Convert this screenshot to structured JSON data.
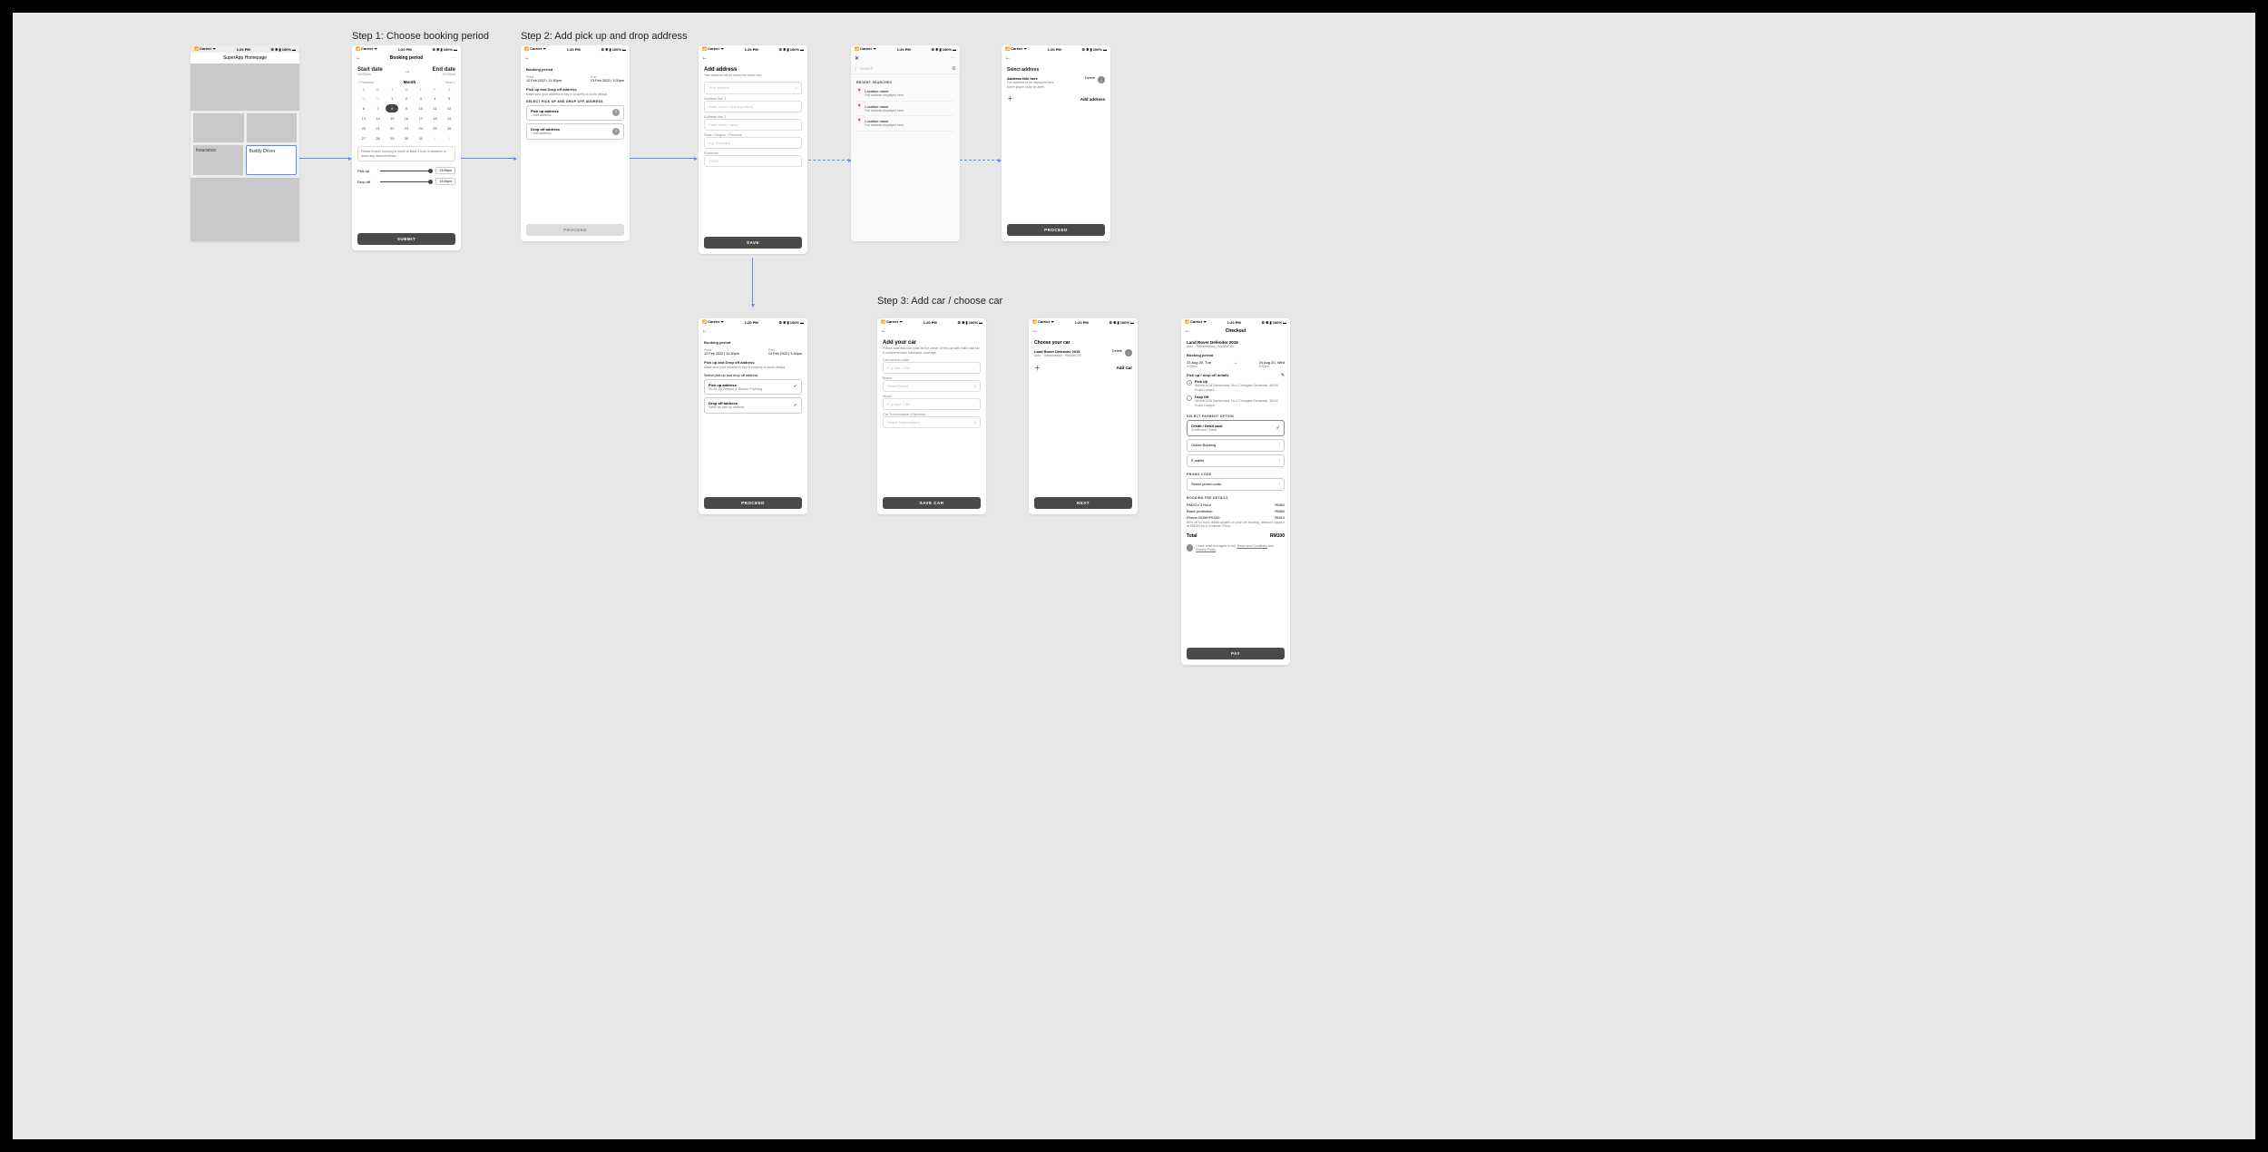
{
  "steps": {
    "s1": "Step 1: Choose booking period",
    "s2": "Step 2: Add pick up and drop address",
    "s3": "Step 3: Add car / choose car"
  },
  "status": {
    "carrier": "Carrier",
    "time": "1:20 PM",
    "battery": "100%"
  },
  "home": {
    "title": "SuperApp Homepage",
    "tile1": "Insurance",
    "tile2": "Buddy Driver"
  },
  "period": {
    "title": "Booking period",
    "start_label": "Start date",
    "start_time": "10:00pm",
    "end_label": "End date",
    "end_time": "10:00pm",
    "prev": "< Previous",
    "month": "Month",
    "next": "Next >",
    "dow": [
      "S",
      "M",
      "T",
      "W",
      "T",
      "F",
      "S"
    ],
    "note": "Please ensure booking is made at least 1 hour in advance to avoid any inconvenience.",
    "pickup": "Pick up",
    "dropoff": "Drop off",
    "slot": "13:00pm",
    "submit": "SUBMIT"
  },
  "step2a": {
    "bp_title": "Booking period",
    "start_l": "Start",
    "start_v": "12 Feb 2022 | 11:30pm",
    "end_l": "End",
    "end_v": "13 Feb 2022 | 3:30pm",
    "pd_title": "Pick up and Drop off address",
    "pd_help": "Make sure your address is key in properly to avoid delays.",
    "sel_title": "SELECT PICK UP AND DROP OFF ADDRESS",
    "pick_t": "Pick up address",
    "pick_s": "+ Add address",
    "drop_t": "Drop off address",
    "drop_s": "+ Add address",
    "proceed": "PROCEED"
  },
  "addaddr": {
    "title": "Add address",
    "sub": "Your address will be saved for future use.",
    "f_your": "Your address",
    "l_l1": "Address line 1",
    "p_l1": "Enter home / building name",
    "l_l2": "Address line 2",
    "p_l2": "Enter street / area",
    "l_state": "State / Region / Province",
    "p_state": "e.g. Selangor",
    "l_post": "Postcode",
    "p_post": "47000",
    "save": "SAVE"
  },
  "search": {
    "ph": "Search",
    "recent": "RECENT SEARCHES",
    "name": "Location name",
    "sub": "Full address displayed here."
  },
  "seladdr": {
    "title": "Select address",
    "card_t": "Address title here",
    "card_s1": "Full address to be displayed here",
    "card_s2": "lorem ipsum dolor sit amet.",
    "delete": "Delete",
    "add": "Add address",
    "proceed": "PROCEED"
  },
  "step3a": {
    "sel_title": "Select pick up and drop off address",
    "pick_s": "No.26 Jln Tempua 5, Bandar Puchong",
    "drop_s": "Same as pick up address",
    "proceed": "PROCEED"
  },
  "addcar": {
    "title": "Add your car",
    "sub": "Please note that you must be the owner of this car with valid road tax & comprehensive insurance coverage.",
    "l_plate": "Car number plate",
    "p_plate": "E.g VAA 1234",
    "l_brand": "Brand",
    "p_brand": "Select Brand",
    "l_model": "Model",
    "p_model": "E.g Myvi 1.5H",
    "l_trans": "Car Transmission (Optional)",
    "p_trans": "Select Transmission",
    "save": "SAVE CAR"
  },
  "choosecar": {
    "title": "Choose your car",
    "car_t": "Land Rover Defender 2015",
    "car_s": "Auto · Transmission · WWW9700",
    "delete": "Delete",
    "add": "Add Car",
    "next": "NEXT"
  },
  "checkout": {
    "title": "Checkout",
    "car_t": "Land Rover Defender 2015",
    "car_s": "Auto · Transmission · WWW9700",
    "bp": "Booking period",
    "d1": "23 Aug 20, Tue",
    "d1t": "4:30pm",
    "d2": "24 Aug 20, Wed",
    "d2t": "6:30pm",
    "pdo_title": "Pick up / drop off details",
    "pu_l": "Pick Up",
    "pu_a": "Wisma UOA Damansara, No.1 Changkat Semantan, 48100 Kuala Lumpur.",
    "do_l": "Drop Off",
    "do_a": "Wisma UOA Damansara, No.1 Changkat Semantan, 48100 Kuala Lumpur.",
    "pay_title": "SELECT PAYMENT OPTION",
    "pay_card": "Credit / Debit card",
    "pay_card_s": "Credit card / Debit",
    "pay_ob": "Online Banking",
    "pay_ew": "E-wallet",
    "promo_t": "PROMO CODE",
    "promo_p": "Select promo code",
    "fee_t": "BOOKING FEE DETAILS",
    "fee1_l": "RM20 x 3 Hour",
    "fee1_v": "RM60",
    "fee2_l": "Basic protection",
    "fee2_v": "RM50",
    "fee3_l": "Promo GOMYROAD",
    "fee3_v": "-RM10",
    "fee3_d": "30% off for food, drinks applied on your 3rd booking, discount capped at RM300 for a minimum 20km.",
    "total_l": "Total",
    "total_v": "RM100",
    "agree1": "I have read and agree to the ",
    "tnc": "Terms and Conditions",
    "and": " and ",
    "pp": "Privacy Policy",
    "pay": "PAY"
  }
}
